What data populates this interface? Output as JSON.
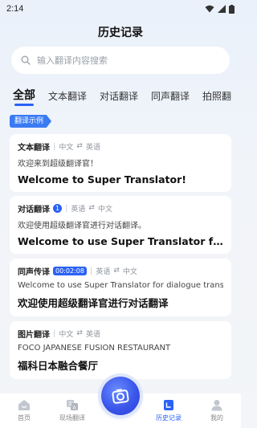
{
  "status_bar": {
    "time": "2:14"
  },
  "header": {
    "title": "历史记录"
  },
  "search": {
    "placeholder": "输入翻译内容搜索"
  },
  "tabs": [
    {
      "label": "全部",
      "active": true
    },
    {
      "label": "文本翻译"
    },
    {
      "label": "对话翻译"
    },
    {
      "label": "同声翻译"
    },
    {
      "label": "拍照翻"
    }
  ],
  "example_badge": "翻译示例",
  "cards": [
    {
      "type": "文本翻译",
      "from": "中文",
      "arrow": "⇄",
      "to": "英语",
      "source": "欢迎来到超级翻译官！",
      "result": "Welcome to Super Translator!"
    },
    {
      "type": "对话翻译",
      "count": "1",
      "from": "英语",
      "arrow": "⇄",
      "to": "中文",
      "source": "欢迎使用超级翻译官进行对话翻译。",
      "result": "Welcome to use Super Translator for di..."
    },
    {
      "type": "同声传译",
      "duration": "00:02:08",
      "from": "英语",
      "arrow": "⇄",
      "to": "中文",
      "source": "Welcome to use Super Translator for dialogue translati...",
      "result": "欢迎使用超级翻译官进行对话翻译"
    },
    {
      "type": "图片翻译",
      "from": "中文",
      "arrow": "⇄",
      "to": "英语",
      "source": "FOCO JAPANESE FUSION RESTAURANT",
      "result": "福科日本融合餐厅"
    }
  ],
  "bottom_nav": [
    {
      "label": "首页",
      "icon": "home-icon"
    },
    {
      "label": "现场翻译",
      "icon": "translate-icon"
    },
    {
      "label": "历史记录",
      "icon": "history-icon",
      "active": true
    },
    {
      "label": "我的",
      "icon": "profile-icon"
    }
  ],
  "colors": {
    "accent": "#2b62f5",
    "badge": "#3a7bf4"
  }
}
